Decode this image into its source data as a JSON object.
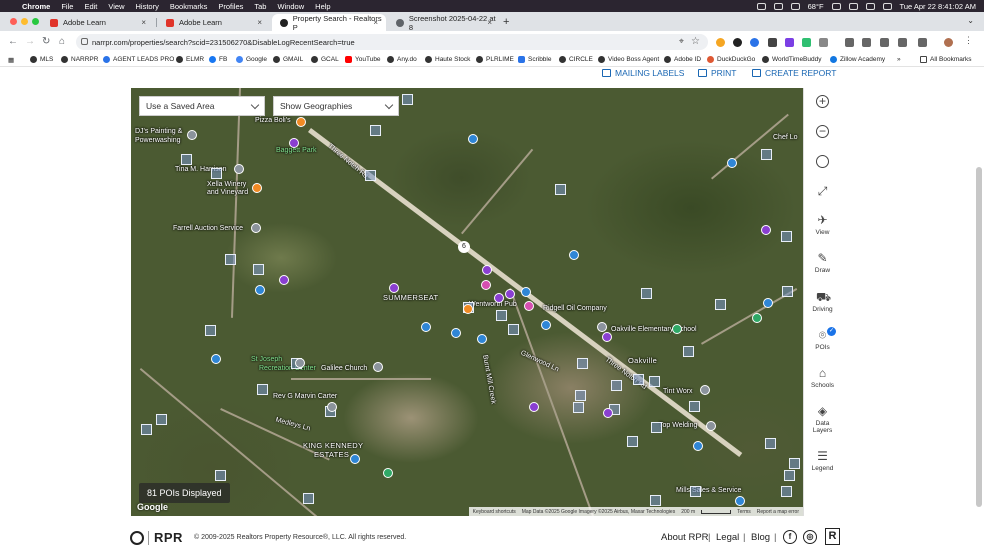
{
  "menubar": {
    "app": "Chrome",
    "items": [
      "File",
      "Edit",
      "View",
      "History",
      "Bookmarks",
      "Profiles",
      "Tab",
      "Window",
      "Help"
    ],
    "weather": "68°F",
    "datetime": "Tue Apr 22  8:41:02 AM"
  },
  "tabs": [
    {
      "title": "Adobe Learn",
      "favicon_color": "#e0342a"
    },
    {
      "title": "Adobe Learn",
      "favicon_color": "#e0342a"
    },
    {
      "title": "Property Search - Realtors P",
      "favicon_color": "#222222"
    },
    {
      "title": "Screenshot 2025-04-22 at 8",
      "favicon_color": "#5f6368"
    }
  ],
  "address": {
    "url": "narrpr.com/properties/search?scid=231506270&DisableLogRecentSearch=true"
  },
  "bookmarks": [
    "MLS",
    "NARRPR",
    "AGENT LEADS PRO",
    "ELMR",
    "FB",
    "Google",
    "GMAIL",
    "GCAL",
    "YouTube",
    "Any.do",
    "Haute Stock",
    "PLRLIME",
    "Scribble",
    "CIRCLE",
    "Video Boss Agent",
    "Adobe ID",
    "DuckDuckGo",
    "WorldTimeBuddy",
    "Zillow Academy"
  ],
  "bookmarks_overflow": "»",
  "bookmarks_all": "All Bookmarks",
  "actions": {
    "mailing_labels": "MAILING LABELS",
    "print": "PRINT",
    "create_report": "CREATE REPORT"
  },
  "map": {
    "saved_area_select": "Use a Saved Area",
    "geographies_select": "Show Geographies",
    "poi_count": "81 POIs Displayed",
    "google": "Google",
    "attribution": {
      "shortcuts": "Keyboard shortcuts",
      "data": "Map Data ©2025 Google Imagery ©2025 Airbus, Maxar Technologies",
      "scale": "200 m",
      "terms": "Terms",
      "report": "Report a map error"
    },
    "labels": {
      "pizza": "Pizza Boli's",
      "djs1": "DJ's Painting &",
      "djs2": "Powerwashing",
      "baggett": "Baggett Park",
      "tina": "Tina M. Harrison",
      "xella1": "Xella Winery",
      "xella2": "and Vineyard",
      "farrell": "Farrell Auction Service",
      "summerseat": "SUMMERSEAT",
      "wentworth": "Wentworth Pub",
      "ridgell": "Ridgell Oil Company",
      "oakville_elem": "Oakville Elementary School",
      "oakville": "Oakville",
      "stjoseph1": "St Joseph",
      "stjoseph2": "Recreation Center",
      "galilee": "Galilee Church",
      "revg": "Rev G Marvin Carter",
      "kingkennedy1": "KING KENNEDY",
      "kingkennedy2": "ESTATES",
      "tintworx": "Tint Worx",
      "topwelding": "Top Welding",
      "miltsales": "Mills Sales & Service",
      "threenotch": "Three Notch Rd",
      "threenotch2": "Three Notch Rd",
      "medleys": "Medleys Ln",
      "burntmill": "Burnt Mill Creek",
      "glenwood": "Glenwood Ln",
      "chef": "Chef Lo",
      "route": "6"
    }
  },
  "tools": {
    "zoom_in": "+",
    "zoom_out": "−",
    "view": "View",
    "draw": "Draw",
    "driving": "Driving",
    "pois": "POIs",
    "schools": "Schools",
    "data_layers_1": "Data",
    "data_layers_2": "Layers",
    "legend": "Legend"
  },
  "footer": {
    "logo": "RPR",
    "copyright": "© 2009-2025 Realtors Property Resource®, LLC. All rights reserved.",
    "about": "About RPR",
    "legal": "Legal",
    "blog": "Blog",
    "sep": "|",
    "facebook": "f",
    "instagram": "◎",
    "realtor": "R"
  }
}
